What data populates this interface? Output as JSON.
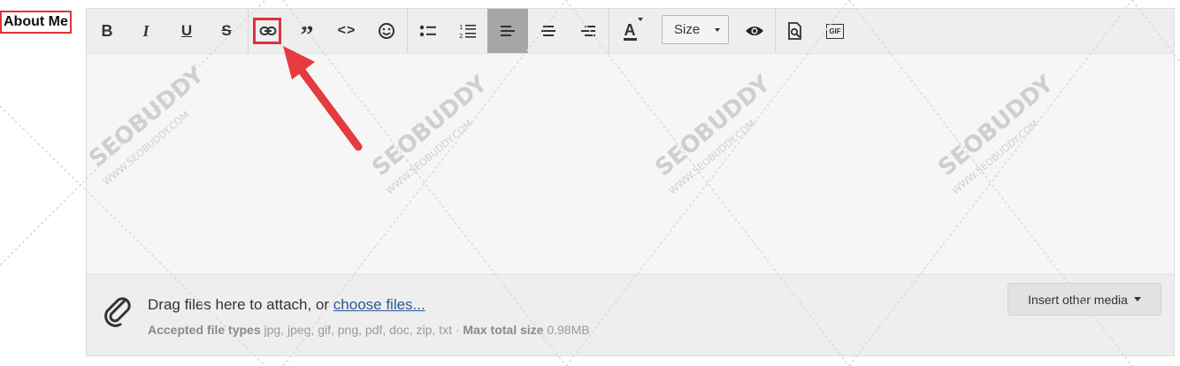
{
  "label": {
    "about_me": "About Me"
  },
  "toolbar": {
    "buttons": [
      {
        "name": "bold",
        "glyph": "B"
      },
      {
        "name": "italic",
        "glyph": "I"
      },
      {
        "name": "underline",
        "glyph": "U"
      },
      {
        "name": "strikethrough",
        "glyph": "S"
      },
      {
        "name": "link",
        "glyph": "link-icon"
      },
      {
        "name": "quote",
        "glyph": "”"
      },
      {
        "name": "code",
        "glyph": "<>"
      },
      {
        "name": "emoji",
        "glyph": "☺"
      },
      {
        "name": "bulleted-list",
        "glyph": "list-icon"
      },
      {
        "name": "numbered-list",
        "glyph": "numbered-list-icon"
      },
      {
        "name": "align-left",
        "glyph": "align-left-icon",
        "active": true
      },
      {
        "name": "align-center",
        "glyph": "align-center-icon"
      },
      {
        "name": "align-right",
        "glyph": "align-right-icon"
      },
      {
        "name": "text-color",
        "glyph": "A"
      },
      {
        "name": "preview",
        "glyph": "eye-icon"
      },
      {
        "name": "toggle-bbcode",
        "glyph": "document-search-icon"
      },
      {
        "name": "gif",
        "glyph": "GIF"
      }
    ],
    "size_label": "Size",
    "highlighted": "link"
  },
  "attachments": {
    "drag_text": "Drag files here to attach, or",
    "choose_link": "choose files...",
    "accepted_label": "Accepted file types",
    "accepted_types": "jpg, jpeg, gif, png, pdf, doc, zip, txt",
    "separator": "·",
    "max_label": "Max total size",
    "max_value": "0.98MB",
    "insert_media": "Insert other media"
  },
  "watermark": {
    "brand": "SEOBUDDY",
    "domain": "WWW.SEOBUDDY.COM"
  },
  "colors": {
    "highlight": "#e0323a",
    "link": "#2b5799",
    "active_button": "#a6a6a6"
  }
}
